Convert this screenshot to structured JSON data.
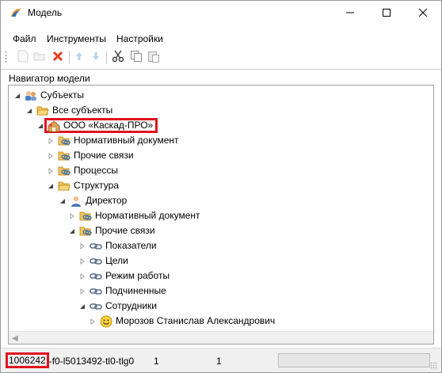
{
  "window": {
    "title": "Модель",
    "controls": [
      "minimize-icon",
      "maximize-icon",
      "close-icon"
    ]
  },
  "menu": {
    "items": [
      "Файл",
      "Инструменты",
      "Настройки"
    ]
  },
  "toolbar": {
    "buttons": [
      "new-icon",
      "open-icon",
      "delete-icon",
      "move-up-icon",
      "move-down-icon",
      "cut-icon",
      "copy-icon",
      "paste-icon"
    ]
  },
  "navigator": {
    "title": "Навигатор модели",
    "tree": [
      {
        "label": "Субъекты",
        "icon": "subjects-icon",
        "expanded": true
      },
      {
        "label": "Все субъекты",
        "icon": "folder-open-icon",
        "expanded": true
      },
      {
        "label": "ООО «Каскад-ПРО»",
        "icon": "organization-icon",
        "expanded": true,
        "highlighted": true
      },
      {
        "label": "Нормативный документ",
        "icon": "folder-link-icon",
        "expanded": false
      },
      {
        "label": "Прочие связи",
        "icon": "folder-link-icon",
        "expanded": false
      },
      {
        "label": "Процессы",
        "icon": "folder-link-icon",
        "expanded": false
      },
      {
        "label": "Структура",
        "icon": "folder-open-icon",
        "expanded": true
      },
      {
        "label": "Директор",
        "icon": "person-icon",
        "expanded": true
      },
      {
        "label": "Нормативный документ",
        "icon": "folder-link-icon",
        "expanded": false
      },
      {
        "label": "Прочие связи",
        "icon": "folder-link-icon",
        "expanded": true
      },
      {
        "label": "Показатели",
        "icon": "link-icon",
        "expanded": false
      },
      {
        "label": "Цели",
        "icon": "link-icon",
        "expanded": false
      },
      {
        "label": "Режим работы",
        "icon": "link-icon",
        "expanded": false
      },
      {
        "label": "Подчиненные",
        "icon": "link-icon",
        "expanded": false
      },
      {
        "label": "Сотрудники",
        "icon": "link-icon",
        "expanded": true
      },
      {
        "label": "Морозов Станислав Александрович",
        "icon": "smiley-icon",
        "expanded": false
      }
    ]
  },
  "status": {
    "id_highlight": "1006242",
    "id_rest": "-f0-l5013492-tl0-tlg0",
    "value1": "1",
    "value2": "1"
  }
}
